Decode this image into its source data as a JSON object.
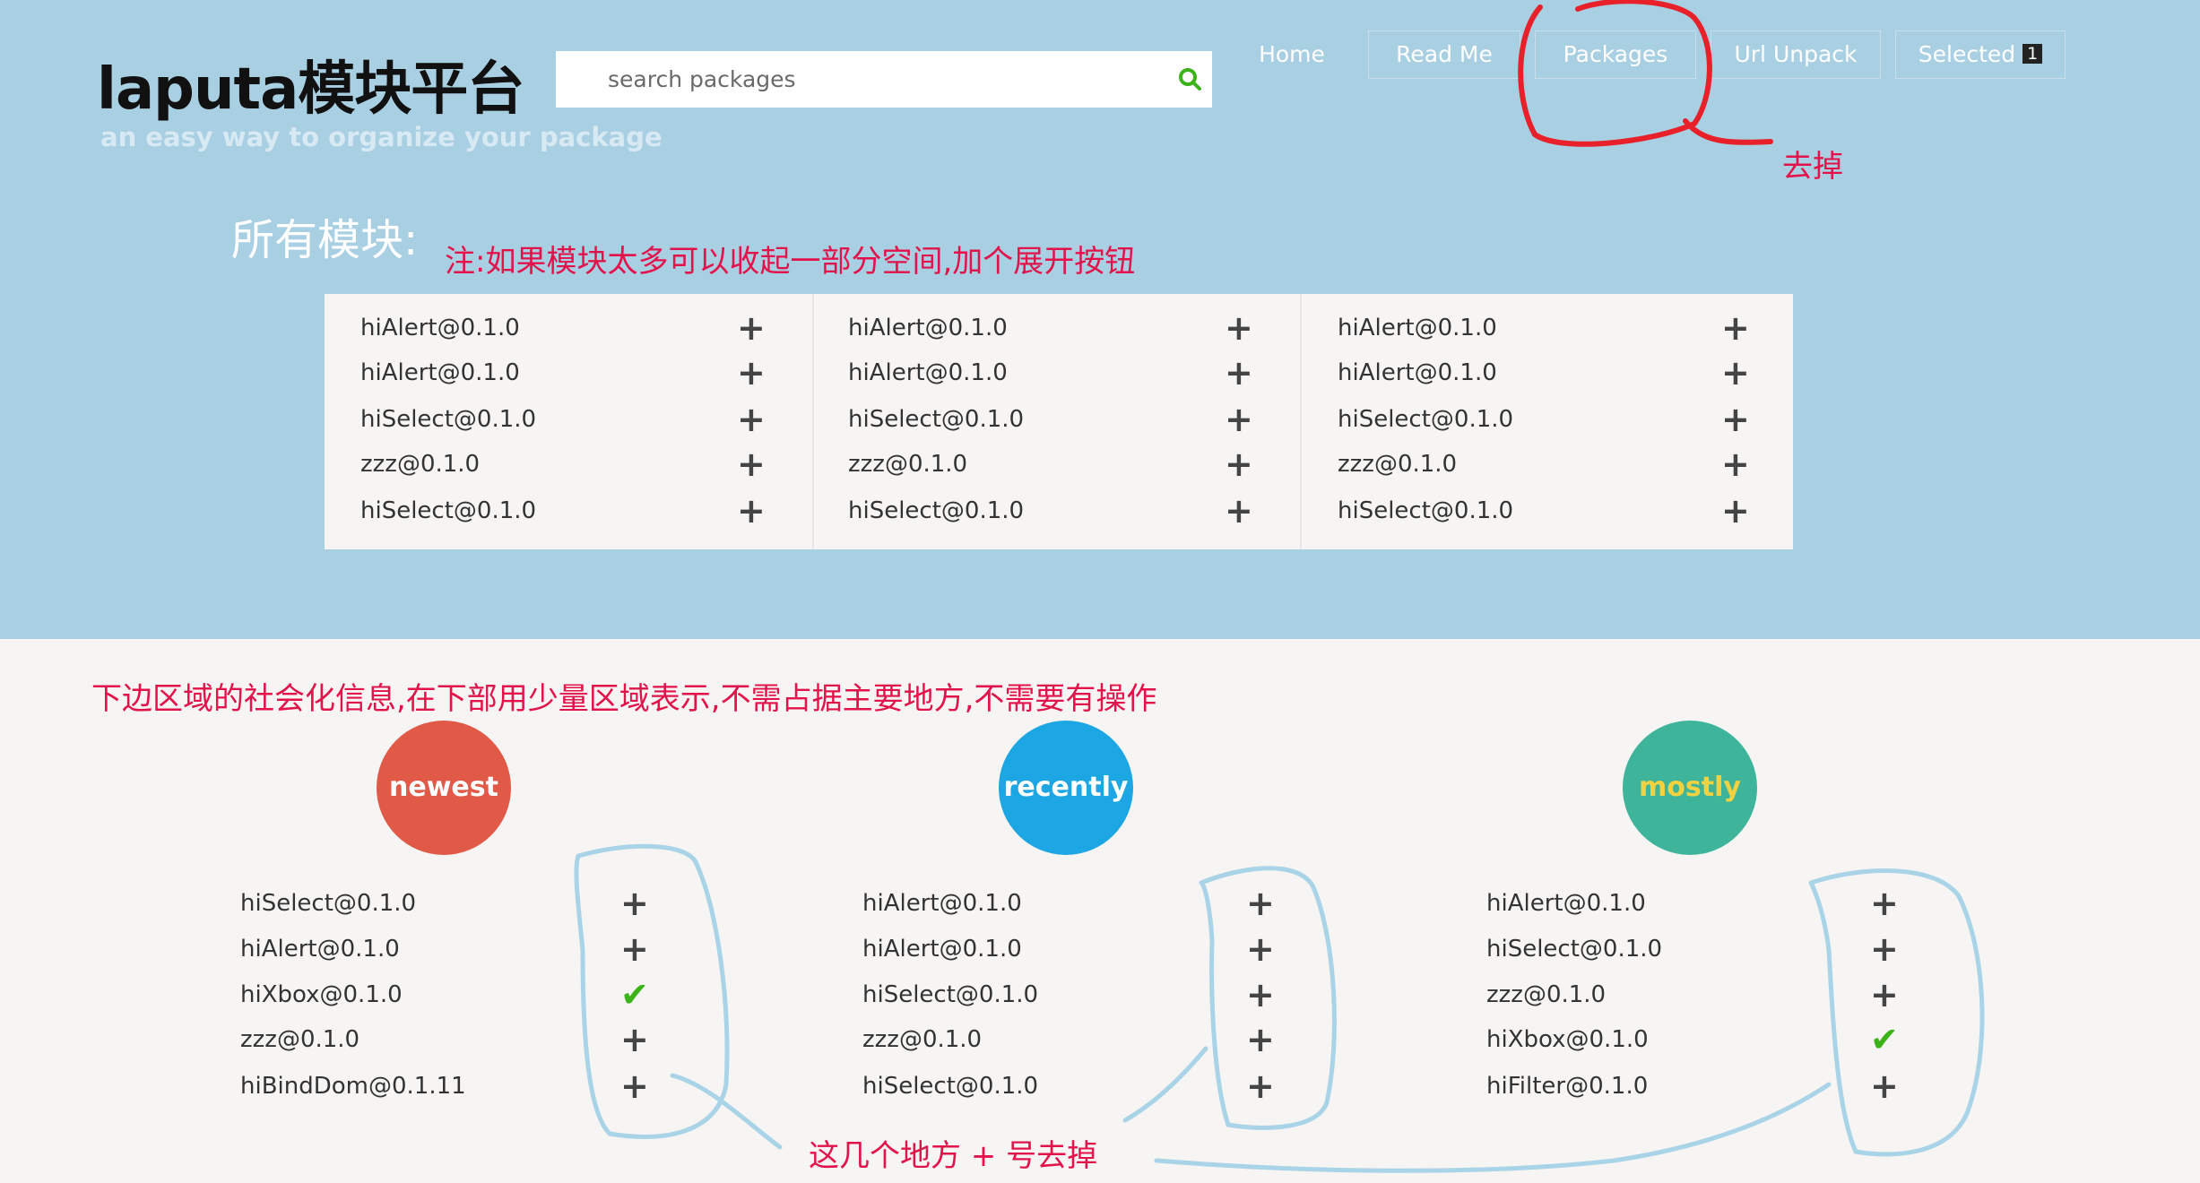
{
  "header": {
    "brand": "laputa模块平台",
    "tagline": "an easy way to organize your package",
    "search_placeholder": "search packages",
    "search_icon": "search-icon",
    "nav": [
      "Home",
      "Read Me",
      "Packages",
      "Url Unpack",
      "Selected"
    ],
    "selected_count": "1"
  },
  "main": {
    "title": "所有模块:",
    "columns": [
      [
        "hiAlert@0.1.0",
        "hiAlert@0.1.0",
        "hiSelect@0.1.0",
        "zzz@0.1.0",
        "hiSelect@0.1.0"
      ],
      [
        "hiAlert@0.1.0",
        "hiAlert@0.1.0",
        "hiSelect@0.1.0",
        "zzz@0.1.0",
        "hiSelect@0.1.0"
      ],
      [
        "hiAlert@0.1.0",
        "hiAlert@0.1.0",
        "hiSelect@0.1.0",
        "zzz@0.1.0",
        "hiSelect@0.1.0"
      ]
    ],
    "add_symbol": "+"
  },
  "social": {
    "sections": [
      {
        "label": "newest",
        "color": "#e05a47",
        "label_color": "#ffffff",
        "items": [
          {
            "name": "hiSelect@0.1.0",
            "state": "add"
          },
          {
            "name": "hiAlert@0.1.0",
            "state": "add"
          },
          {
            "name": "hiXbox@0.1.0",
            "state": "selected"
          },
          {
            "name": "zzz@0.1.0",
            "state": "add"
          },
          {
            "name": "hiBindDom@0.1.11",
            "state": "add"
          }
        ]
      },
      {
        "label": "recently",
        "color": "#1ca6e3",
        "label_color": "#ffffff",
        "items": [
          {
            "name": "hiAlert@0.1.0",
            "state": "add"
          },
          {
            "name": "hiAlert@0.1.0",
            "state": "add"
          },
          {
            "name": "hiSelect@0.1.0",
            "state": "add"
          },
          {
            "name": "zzz@0.1.0",
            "state": "add"
          },
          {
            "name": "hiSelect@0.1.0",
            "state": "add"
          }
        ]
      },
      {
        "label": "mostly",
        "color": "#3eb59b",
        "label_color": "#f4d23f",
        "items": [
          {
            "name": "hiAlert@0.1.0",
            "state": "add"
          },
          {
            "name": "hiSelect@0.1.0",
            "state": "add"
          },
          {
            "name": "zzz@0.1.0",
            "state": "add"
          },
          {
            "name": "hiXbox@0.1.0",
            "state": "selected"
          },
          {
            "name": "hiFilter@0.1.0",
            "state": "add"
          }
        ]
      }
    ],
    "check_symbol": "✔"
  },
  "annotations": {
    "packages_note": "去掉",
    "collapse_note": "注:如果模块太多可以收起一部分空间,加个展开按钮",
    "social_note": "下边区域的社会化信息,在下部用少量区域表示,不需占据主要地方,不需要有操作",
    "plus_note": "这几个地方 + 号去掉"
  },
  "colors": {
    "header_bg": "#a9cfe3",
    "page_bg": "#f6f5f3",
    "annotation_red": "#e2124a",
    "scribble_red": "#e8202a",
    "scribble_blue": "#a9d3e6",
    "check_green": "#3db31a"
  }
}
